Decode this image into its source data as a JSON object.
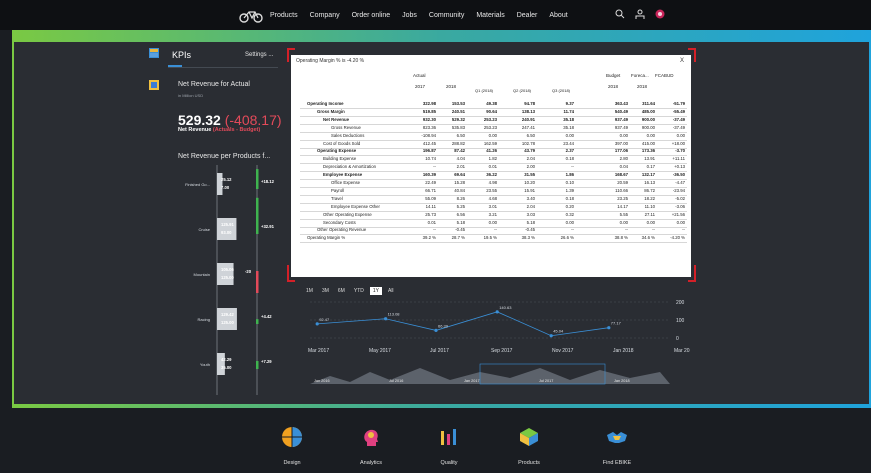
{
  "nav": {
    "items": [
      "Products",
      "Company",
      "Order online",
      "Jobs",
      "Community",
      "Materials",
      "Dealer",
      "About"
    ],
    "icons": [
      "bike-logo",
      "search-icon",
      "person-icon",
      "flag-icon"
    ]
  },
  "kpi": {
    "title": "KPIs",
    "settings": "Settings ...",
    "net_revenue_label": "Net Revenue for Actual",
    "net_revenue_unit": "in Million USD",
    "net_revenue_value": "529.32",
    "net_revenue_delta": "(-408.17)",
    "net_revenue_sub": "Net Revenue",
    "net_revenue_sub_red": "(Actuals - Budget)",
    "net_rev_products_label": "Net Revenue per Products f...",
    "products": [
      {
        "name": "Finished Go...",
        "v1": "25.12",
        "v2": "7.00",
        "delta": "+18.12"
      },
      {
        "name": "Cruise",
        "v1": "125.91",
        "v2": "93.00",
        "delta": "+32.91"
      },
      {
        "name": "Mountain",
        "v1": "105.06",
        "v2": "125.00",
        "delta": "-20"
      },
      {
        "name": "Racing",
        "v1": "129.42",
        "v2": "125.00",
        "delta": "+4.42"
      },
      {
        "name": "Youth",
        "v1": "42.29",
        "v2": "35.00",
        "delta": "+7.29"
      }
    ]
  },
  "modal": {
    "title": "Operating Margin % is -4.20 %",
    "close": "X",
    "headers": {
      "actual": "Actual",
      "y2017": "2017",
      "y2018": "2018",
      "q1": "Q1 (2018)",
      "q2": "Q2 (2018)",
      "q3": "Q3 (2018)",
      "budget": "Budget",
      "budget_year": "2018",
      "forecast": "Foreca...",
      "forecast_year": "2018",
      "fcabud": "FCABUD"
    },
    "rows": [
      {
        "label": "Operating Income",
        "bold": true,
        "indent": 0,
        "values": [
          "322.98",
          "153.53",
          "49.38",
          "94.78",
          "9.37",
          "363.43",
          "311.64",
          "-51.79"
        ]
      },
      {
        "label": "Gross Margin",
        "bold": true,
        "indent": 1,
        "values": [
          "519.85",
          "240.51",
          "90.64",
          "138.13",
          "11.74",
          "540.49",
          "485.00",
          "-55.49"
        ]
      },
      {
        "label": "Net Revenue",
        "bold": true,
        "indent": 2,
        "values": [
          "932.30",
          "529.32",
          "253.23",
          "240.91",
          "35.18",
          "937.49",
          "900.00",
          "-37.49"
        ]
      },
      {
        "label": "Gross Revenue",
        "bold": false,
        "indent": 3,
        "values": [
          "823.36",
          "535.83",
          "253.23",
          "247.41",
          "35.18",
          "937.49",
          "900.00",
          "-37.49"
        ]
      },
      {
        "label": "Sales Deductions",
        "bold": false,
        "indent": 3,
        "values": [
          "-108.94",
          "6.50",
          "0.00",
          "6.50",
          "0.00",
          "0.00",
          "0.00",
          "0.00"
        ]
      },
      {
        "label": "Cost of Goods Sold",
        "bold": false,
        "indent": 2,
        "values": [
          "412.45",
          "288.82",
          "162.59",
          "102.78",
          "23.44",
          "397.00",
          "415.00",
          "+18.00"
        ]
      },
      {
        "label": "Operating Expense",
        "bold": true,
        "indent": 1,
        "values": [
          "196.87",
          "87.42",
          "41.26",
          "43.79",
          "2.37",
          "177.06",
          "173.36",
          "-3.70"
        ]
      },
      {
        "label": "Building Expense",
        "bold": false,
        "indent": 2,
        "values": [
          "10.74",
          "4.04",
          "1.82",
          "2.04",
          "0.18",
          "2.80",
          "13.91",
          "+11.11"
        ]
      },
      {
        "label": "Depreciation & Amortization",
        "bold": false,
        "indent": 2,
        "values": [
          "--",
          "2.01",
          "0.01",
          "2.00",
          "--",
          "0.04",
          "0.17",
          "+0.13"
        ]
      },
      {
        "label": "Employee Expense",
        "bold": true,
        "indent": 2,
        "values": [
          "160.39",
          "69.64",
          "36.22",
          "31.55",
          "1.86",
          "168.67",
          "132.17",
          "-36.50"
        ]
      },
      {
        "label": "Office Expense",
        "bold": false,
        "indent": 3,
        "values": [
          "22.49",
          "15.28",
          "4.98",
          "10.20",
          "0.10",
          "20.59",
          "16.13",
          "-4.47"
        ]
      },
      {
        "label": "Payroll",
        "bold": false,
        "indent": 3,
        "values": [
          "66.71",
          "40.84",
          "23.55",
          "15.91",
          "1.39",
          "110.66",
          "86.72",
          "-23.94"
        ]
      },
      {
        "label": "Travel",
        "bold": false,
        "indent": 3,
        "values": [
          "55.09",
          "8.26",
          "4.68",
          "3.40",
          "0.18",
          "23.25",
          "18.22",
          "-5.02"
        ]
      },
      {
        "label": "Employee Expense Other",
        "bold": false,
        "indent": 3,
        "values": [
          "14.11",
          "5.25",
          "3.01",
          "2.04",
          "0.20",
          "14.17",
          "11.10",
          "-3.06"
        ]
      },
      {
        "label": "Other Operating Expense",
        "bold": false,
        "indent": 2,
        "values": [
          "25.73",
          "6.56",
          "3.21",
          "3.03",
          "0.32",
          "5.55",
          "27.11",
          "+21.56"
        ]
      },
      {
        "label": "Secondary Costs",
        "bold": false,
        "indent": 2,
        "values": [
          "0.01",
          "5.18",
          "0.00",
          "5.18",
          "0.00",
          "0.00",
          "0.00",
          "0.00"
        ]
      },
      {
        "label": "Other Operating Revenue",
        "bold": false,
        "indent": 1,
        "values": [
          "--",
          "-0.45",
          "--",
          "-0.45",
          "--",
          "--",
          "--",
          "--"
        ]
      },
      {
        "label": "Operating Margin %",
        "bold": false,
        "indent": 0,
        "values": [
          "39.2 %",
          "28.7 %",
          "19.5 %",
          "38.3 %",
          "26.6 %",
          "38.8 %",
          "34.6 %",
          "-4.20 %"
        ]
      }
    ]
  },
  "zoom": [
    "1M",
    "3M",
    "6M",
    "YTD",
    "1Y",
    "All"
  ],
  "zoom_active": "1Y",
  "chart_data": {
    "type": "line",
    "x": [
      "Mar 2017",
      "May 2017",
      "Jul 2017",
      "Sep 2017",
      "Nov 2017",
      "Jan 2018",
      "Mar 2018"
    ],
    "points": [
      {
        "label": "92.47",
        "x": 0.02,
        "y": 92.47
      },
      {
        "label": "113.08",
        "x": 0.21,
        "y": 113.08
      },
      {
        "label": "66.39",
        "x": 0.35,
        "y": 66.39
      },
      {
        "label": "140.63",
        "x": 0.52,
        "y": 140.63
      },
      {
        "label": "45.04",
        "x": 0.67,
        "y": 45.04
      },
      {
        "label": "77.17",
        "x": 0.83,
        "y": 77.17
      }
    ],
    "yticks": [
      "200",
      "100",
      "0"
    ],
    "ylim": [
      0,
      200
    ],
    "navigator_labels": [
      "Jan 2016",
      "Jul 2016",
      "Jan 2017",
      "Jul 2017",
      "Jan 2018"
    ]
  },
  "footer": [
    {
      "label": "Design",
      "icon": "globe-icon"
    },
    {
      "label": "Analytics",
      "icon": "head-icon"
    },
    {
      "label": "Quality",
      "icon": "spark-icon"
    },
    {
      "label": "Products",
      "icon": "box-icon"
    },
    {
      "label": "Find EBIKE",
      "icon": "handshake-icon"
    }
  ],
  "colors": {
    "accent_blue": "#3a8fd6",
    "negative": "#e34a5a",
    "positive": "#3fb34f",
    "highlight": "#d32028"
  }
}
